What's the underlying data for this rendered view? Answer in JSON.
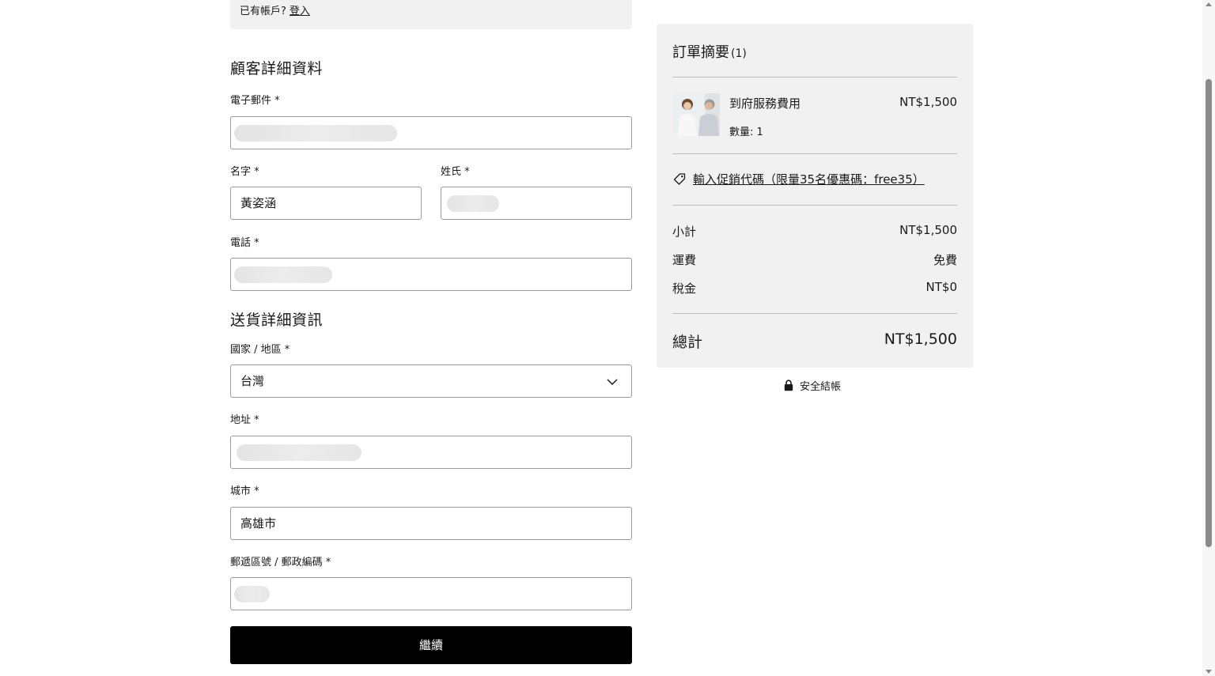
{
  "login_bar": {
    "prompt": "已有帳戶?",
    "link": "登入"
  },
  "customer": {
    "title": "顧客詳細資料",
    "email_label": "電子郵件 *",
    "first_name_label": "名字 *",
    "first_name_value": "黃姿涵",
    "last_name_label": "姓氏 *",
    "phone_label": "電話 *"
  },
  "shipping": {
    "title": "送貨詳細資訊",
    "country_label": "國家 / 地區 *",
    "country_value": "台灣",
    "address_label": "地址 *",
    "city_label": "城市 *",
    "city_value": "高雄市",
    "zip_label": "郵遞區號 / 郵政編碼 *"
  },
  "continue_label": "繼續",
  "summary": {
    "title": "訂單摘要",
    "count": "(1)",
    "item_name": "到府服務費用",
    "item_qty": "數量: 1",
    "item_price": "NT$1,500",
    "promo": "輸入促銷代碼（限量35名優惠碼：free35）",
    "subtotal_label": "小計",
    "subtotal_value": "NT$1,500",
    "shipping_label": "運費",
    "shipping_value": "免費",
    "tax_label": "稅金",
    "tax_value": "NT$0",
    "total_label": "總計",
    "total_value": "NT$1,500"
  },
  "secure_checkout": "安全結帳",
  "colors": {
    "button": "#000000",
    "panel": "#f1f1f1",
    "border": "#999999"
  },
  "icons": [
    "tag-icon",
    "lock-icon",
    "chevron-down-icon"
  ]
}
